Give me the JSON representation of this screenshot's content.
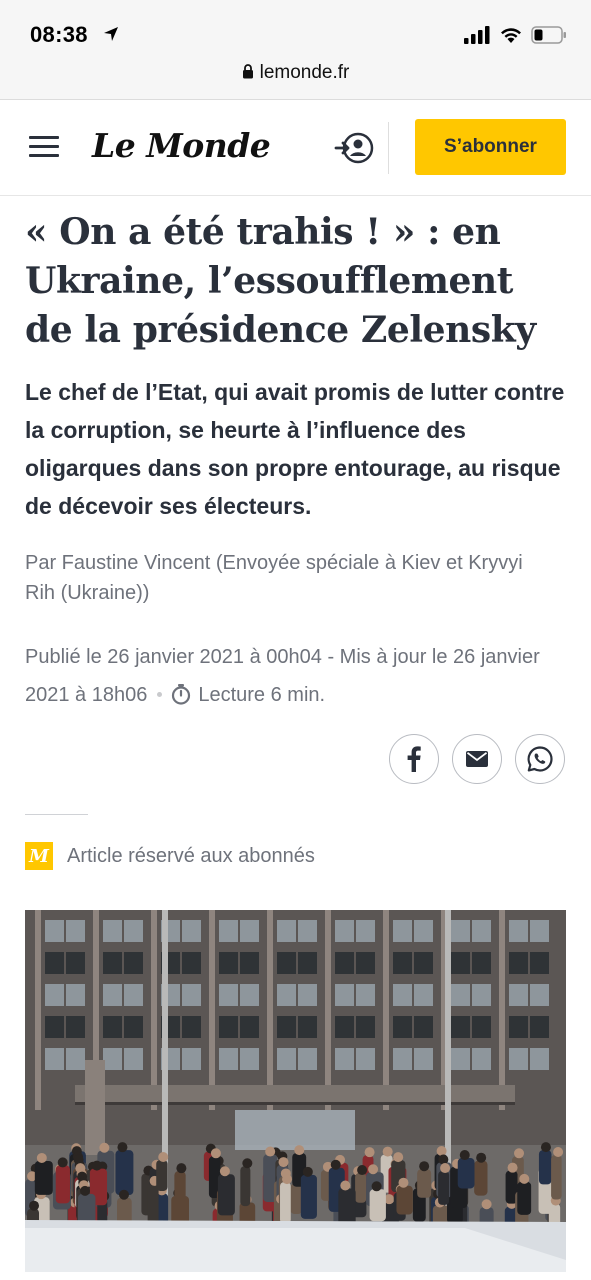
{
  "status_bar": {
    "time": "08:38"
  },
  "browser": {
    "url": "lemonde.fr"
  },
  "header": {
    "logo": "Le Monde",
    "subscribe_label": "S’abonner"
  },
  "article": {
    "headline": "« On a été trahis ! » : en Ukraine, l’essoufflement de la présidence Zelensky",
    "lede": "Le chef de l’Etat, qui avait promis de lutter contre la corruption, se heurte à l’influence des oligarques dans son propre entourage, au risque de décevoir ses électeurs.",
    "byline": "Par Faustine Vincent (Envoyée spéciale à Kiev et Kryvyi Rih (Ukraine))",
    "published": "Publié le 26 janvier 2021 à 00h04 - Mis à jour le 26 janvier 2021 à 18h06",
    "reading_time": "Lecture 6 min.",
    "premium_badge": "M",
    "premium_label": "Article réservé aux abonnés"
  },
  "colors": {
    "accent": "#ffc700",
    "text": "#2a303b",
    "muted": "#6e727b"
  }
}
